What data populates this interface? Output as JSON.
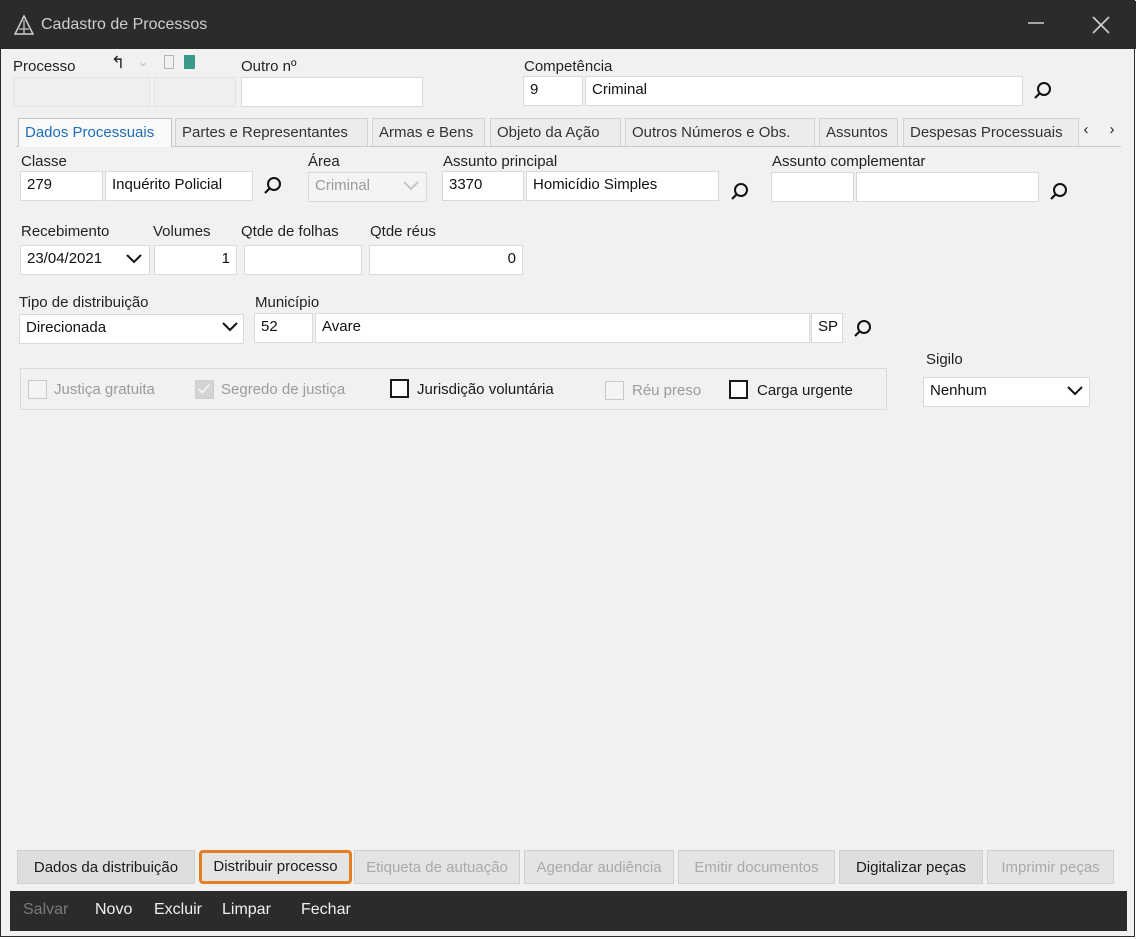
{
  "window": {
    "title": "Cadastro de Processos"
  },
  "header": {
    "processo_label": "Processo",
    "outro_label": "Outro nº",
    "outro_value": "",
    "competencia_label": "Competência",
    "competencia_code": "9",
    "competencia_name": "Criminal"
  },
  "tabs": [
    {
      "label": "Dados Processuais"
    },
    {
      "label": "Partes e Representantes"
    },
    {
      "label": "Armas e Bens"
    },
    {
      "label": "Objeto da Ação"
    },
    {
      "label": "Outros Números e Obs."
    },
    {
      "label": "Assuntos"
    },
    {
      "label": "Despesas Processuais"
    }
  ],
  "form": {
    "classe_label": "Classe",
    "classe_code": "279",
    "classe_name": "Inquérito Policial",
    "area_label": "Área",
    "area_value": "Criminal",
    "assunto_label": "Assunto principal",
    "assunto_code": "3370",
    "assunto_name": "Homicídio Simples",
    "assunto_comp_label": "Assunto complementar",
    "assunto_comp_code": "",
    "assunto_comp_name": "",
    "recebimento_label": "Recebimento",
    "recebimento_value": "23/04/2021",
    "volumes_label": "Volumes",
    "volumes_value": "1",
    "folhas_label": "Qtde de folhas",
    "folhas_value": "",
    "reus_label": "Qtde réus",
    "reus_value": "0",
    "tipo_label": "Tipo de distribuição",
    "tipo_value": "Direcionada",
    "municipio_label": "Município",
    "municipio_code": "52",
    "municipio_name": "Avare",
    "municipio_uf": "SP",
    "sigilo_label": "Sigilo",
    "sigilo_value": "Nenhum"
  },
  "checkboxes": [
    {
      "label": "Justiça gratuita",
      "enabled": false,
      "checked": false
    },
    {
      "label": "Segredo de justiça",
      "enabled": false,
      "checked": true
    },
    {
      "label": "Jurisdição voluntária",
      "enabled": true,
      "checked": false
    },
    {
      "label": "Réu preso",
      "enabled": false,
      "checked": false
    },
    {
      "label": "Carga urgente",
      "enabled": true,
      "checked": false
    }
  ],
  "actions": [
    {
      "label": "Dados da distribuição",
      "enabled": true
    },
    {
      "label": "Distribuir processo",
      "enabled": true
    },
    {
      "label": "Etiqueta de autuação",
      "enabled": false
    },
    {
      "label": "Agendar audiência",
      "enabled": false
    },
    {
      "label": "Emitir documentos",
      "enabled": false
    },
    {
      "label": "Digitalizar peças",
      "enabled": true
    },
    {
      "label": "Imprimir peças",
      "enabled": false
    }
  ],
  "bottom": {
    "salvar": "Salvar",
    "novo": "Novo",
    "excluir": "Excluir",
    "limpar": "Limpar",
    "fechar": "Fechar"
  },
  "colors": {
    "highlight": "#e67e22",
    "active_tab": "#1e6db6",
    "titlebar": "#2b2b2b"
  }
}
